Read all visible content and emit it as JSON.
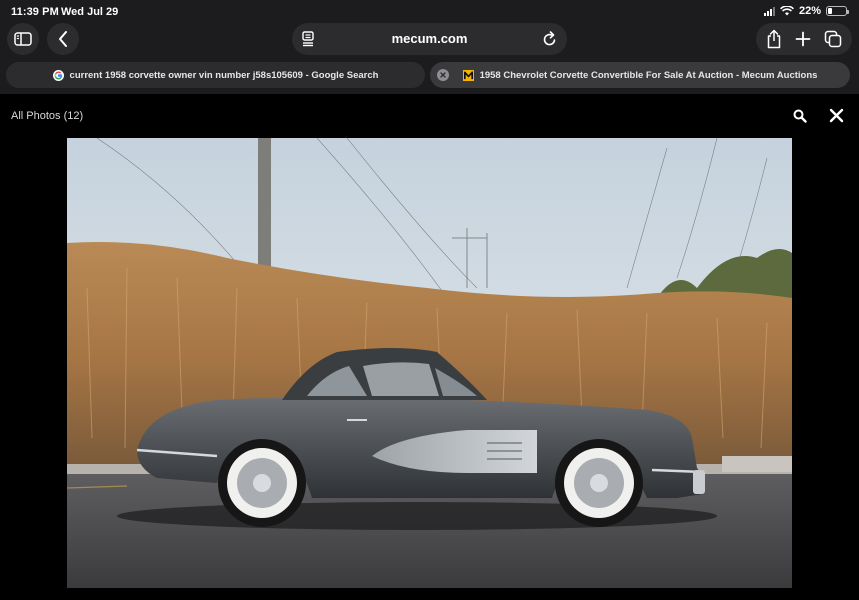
{
  "status_bar": {
    "time": "11:39 PM",
    "date": "Wed Jul 29",
    "battery_percent": "22%",
    "battery_level": 0.22,
    "icons": [
      "signal-icon",
      "wifi-icon",
      "battery-icon"
    ]
  },
  "toolbar": {
    "url": "mecum.com",
    "icons": [
      "sidebar-icon",
      "back-icon",
      "page-menu-icon",
      "reload-icon",
      "share-icon",
      "new-tab-icon",
      "tabs-icon"
    ]
  },
  "tabs": [
    {
      "title": "current 1958 corvette owner vin number j58s105609 - Google Search",
      "favicon": "google-icon",
      "active": false
    },
    {
      "title": "1958 Chevrolet Corvette Convertible For Sale At Auction - Mecum Auctions",
      "favicon": "mecum-icon",
      "active": true
    }
  ],
  "gallery": {
    "label": "All Photos (12)",
    "icons": [
      "zoom-icon",
      "close-icon"
    ]
  },
  "photo": {
    "subject": "photo-1958-corvette-side"
  },
  "colors": {
    "chrome_bg": "#1c1c1e",
    "button_bg": "#2c2c2e",
    "page_bg": "#000000",
    "mecum_brand": "#f5b400"
  }
}
